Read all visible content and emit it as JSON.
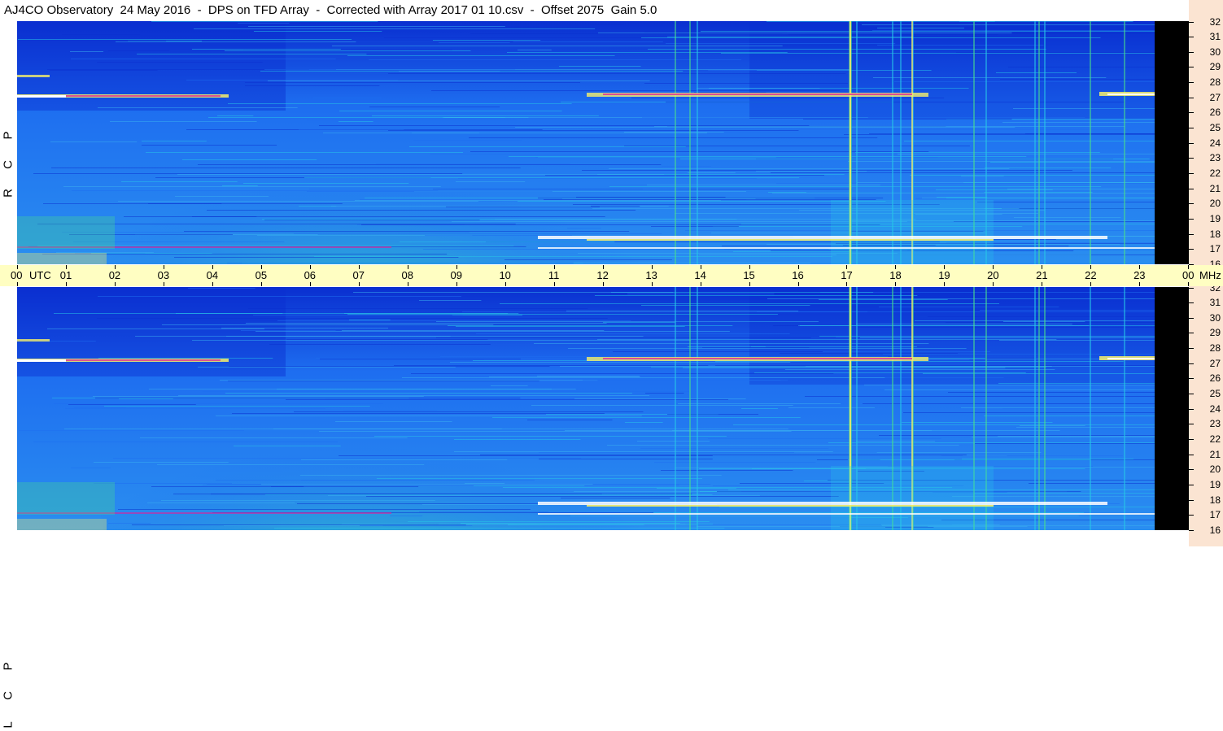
{
  "title": "AJ4CO Observatory  24 May 2016  -  DPS on TFD Array  -  Corrected with Array 2017 01 10.csv  -  Offset 2075  Gain 5.0",
  "time_axis": {
    "labels": [
      "00",
      "UTC",
      "01",
      "02",
      "03",
      "04",
      "05",
      "06",
      "07",
      "08",
      "09",
      "10",
      "11",
      "12",
      "13",
      "14",
      "15",
      "16",
      "17",
      "18",
      "19",
      "20",
      "21",
      "22",
      "23",
      "00",
      "MHz"
    ]
  },
  "freq_axis": {
    "ticks": [
      "32",
      "31",
      "30",
      "29",
      "28",
      "27",
      "26",
      "25",
      "24",
      "23",
      "22",
      "21",
      "20",
      "19",
      "18",
      "17",
      "16"
    ]
  },
  "panels": {
    "top": {
      "pol_letters": [
        "P",
        "C",
        "R"
      ]
    },
    "bottom": {
      "pol_letters": [
        "P",
        "C",
        "L"
      ]
    }
  },
  "colors": {
    "deep_blue": "#0a2fd0",
    "mid_blue": "#1e6ef0",
    "cyan": "#27c6e8",
    "green": "#48e08a",
    "yellow": "#f6f06a",
    "white": "#ffffff",
    "magenta": "#e0209a",
    "axis_bg": "#fbe4d2",
    "timebar_bg": "#fffec2"
  }
}
